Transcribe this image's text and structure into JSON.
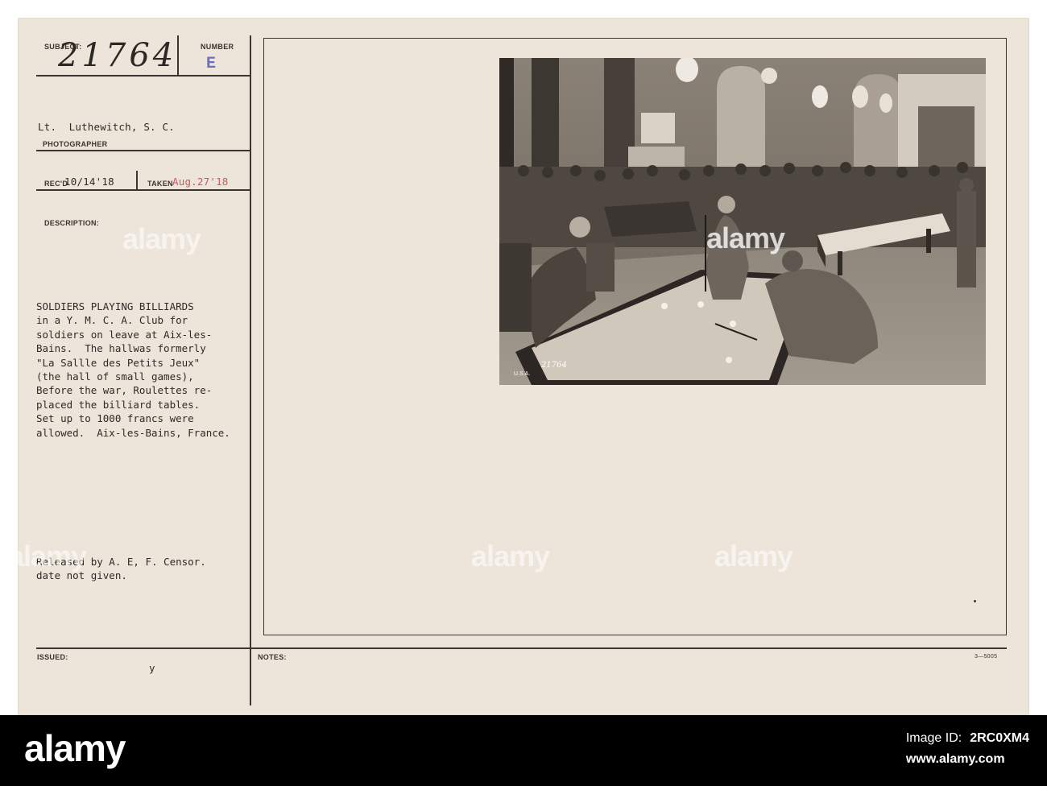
{
  "card": {
    "subject_label": "SUBJECT:",
    "subject_value": "21764",
    "number_label": "NUMBER",
    "number_value": "E",
    "photographer_name": "Lt.  Luthewitch, S. C.",
    "photographer_label": "PHOTOGRAPHER",
    "recd_label": "REC'D",
    "recd_value": "10/14'18",
    "taken_label": "TAKEN",
    "taken_value": "Aug.27'18",
    "description_label": "DESCRIPTION:",
    "description_lines": [
      "SOLDIERS PLAYING BILLIARDS",
      "in a Y. M. C. A. Club for",
      "soldiers on leave at Aix-les-",
      "Bains.  The hallwas formerly",
      "\"La Sallle des Petits Jeux\"",
      "(the hall of small games),",
      "Before the war, Roulettes re-",
      "placed the billiard tables.",
      "Set up to 1000 francs were",
      "allowed.  Aix-les-Bains, France."
    ],
    "released_lines": [
      "Released by A. E, F. Censor.",
      "date not given."
    ],
    "issued_label": "ISSUED:",
    "issued_value": "y",
    "notes_label": "NOTES:",
    "form_code": "3—5005"
  },
  "photo": {
    "plate_number": "21764",
    "plate_mark": "U.S.A."
  },
  "watermarks": {
    "brand": "alamy"
  },
  "footer": {
    "logo": "alamy",
    "image_id_label": "Image ID:",
    "image_id": "2RC0XM4",
    "site": "www.alamy.com"
  },
  "colors": {
    "card_background": "#ede5d9",
    "ink": "#2e2a27",
    "red_stamp": "#d0556a",
    "blue_stamp": "#6e6fc4",
    "footer_background": "#000000"
  }
}
